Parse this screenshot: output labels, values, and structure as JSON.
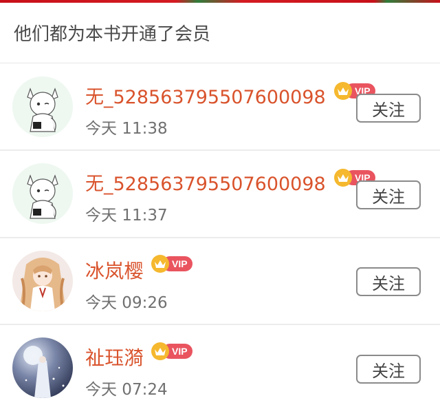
{
  "header": {
    "title": "他们都为本书开通了会员"
  },
  "vip_label": "VIP",
  "follow_label": "关注",
  "colors": {
    "name": "#d9532c",
    "vip_pill": "#e9545f",
    "vip_crown": "#f5b82e",
    "banner": "#c8101a"
  },
  "members": [
    {
      "name": "无_528563795507600098",
      "time": "今天 11:38",
      "avatar_icon": "anime-cat-girl-avatar",
      "vip": true
    },
    {
      "name": "无_528563795507600098",
      "time": "今天 11:37",
      "avatar_icon": "anime-cat-girl-avatar",
      "vip": true
    },
    {
      "name": "冰岚樱",
      "time": "今天 09:26",
      "avatar_icon": "anime-long-hair-girl-avatar",
      "vip": true
    },
    {
      "name": "祉珏漪",
      "time": "今天 07:24",
      "avatar_icon": "moonlit-figure-avatar",
      "vip": true
    }
  ]
}
